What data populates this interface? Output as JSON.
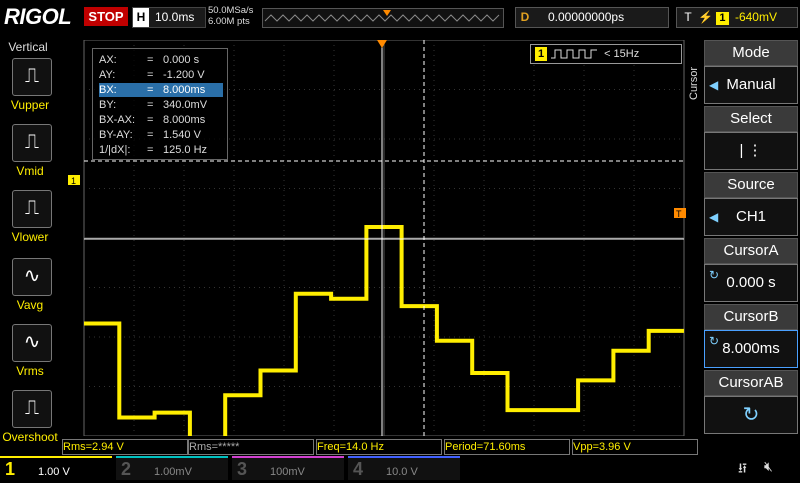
{
  "brand": "RIGOL",
  "run_state": "STOP",
  "timebase": {
    "h": "H",
    "value": "10.0ms"
  },
  "sample": {
    "rate": "50.0MSa/s",
    "points": "6.00M pts"
  },
  "delay": {
    "d": "D",
    "value": "0.00000000ps"
  },
  "trigger": {
    "t": "T",
    "channel": "1",
    "level": "-640mV"
  },
  "left_panel": {
    "title": "Vertical",
    "items": [
      "Vupper",
      "Vmid",
      "Vlower",
      "Vavg",
      "Vrms",
      "Overshoot"
    ]
  },
  "cursor_readout": [
    {
      "key": "AX:",
      "value": "0.000 s"
    },
    {
      "key": "AY:",
      "value": "-1.200 V"
    },
    {
      "key": "BX:",
      "value": "8.000ms"
    },
    {
      "key": "BY:",
      "value": "340.0mV"
    },
    {
      "key": "BX-AX:",
      "value": "8.000ms"
    },
    {
      "key": "BY-AY:",
      "value": "1.540 V"
    },
    {
      "key": "1/|dX|:",
      "value": "125.0 Hz"
    }
  ],
  "channel_badge": {
    "ch": "1",
    "freq": "< 15Hz"
  },
  "markers": {
    "trigger_top": "T",
    "ch1_level": "1",
    "trig_level": "T"
  },
  "right_menu": {
    "side_label": "Cursor",
    "mode": {
      "title": "Mode",
      "value": "Manual"
    },
    "select": {
      "title": "Select",
      "value": "| ⋮"
    },
    "source": {
      "title": "Source",
      "value": "CH1"
    },
    "cursor_a": {
      "title": "CursorA",
      "value": "0.000 s"
    },
    "cursor_b": {
      "title": "CursorB",
      "value": "8.000ms"
    },
    "cursor_ab": {
      "title": "CursorAB",
      "value": "↻"
    }
  },
  "measurements": [
    "Rms=2.94 V",
    "Rms=*****",
    "Freq=14.0 Hz",
    "Period=71.60ms",
    "Vpp=3.96 V"
  ],
  "channels": [
    {
      "n": "1",
      "scale": "1.00 V",
      "color": "#ffee00"
    },
    {
      "n": "2",
      "scale": "1.00mV",
      "color": "#00c0c0"
    },
    {
      "n": "3",
      "scale": "100mV",
      "color": "#d040d0"
    },
    {
      "n": "4",
      "scale": "10.0 V",
      "color": "#4060ff"
    }
  ],
  "colors": {
    "ch1": "#ffee00",
    "stop": "#c00000",
    "trigger_orange": "#ff8a00"
  },
  "waveform": {
    "levels_div": [
      1.95,
      0.05,
      0.15,
      -0.5,
      0.5,
      1.0,
      2.55,
      2.45,
      3.9,
      2.3,
      1.6,
      0.95,
      0.2,
      0.2,
      0.8,
      1.4,
      1.8
    ]
  }
}
